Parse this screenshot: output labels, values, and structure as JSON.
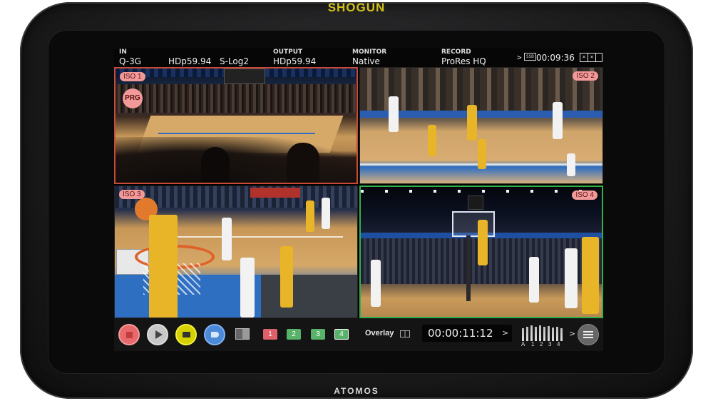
{
  "device": {
    "brand_top": "SHOGUN",
    "brand_top_color": "#d4c21a",
    "brand_bottom": "ATOMOS",
    "brand_bottom_color": "#d8d8d8"
  },
  "status_bar": {
    "in": {
      "label": "IN",
      "value": "Q-3G"
    },
    "in_format": "HDp59.94",
    "in_log": "S-Log2",
    "output": {
      "label": "OUTPUT",
      "value": "HDp59.94"
    },
    "monitor": {
      "label": "MONITOR",
      "value": "Native"
    },
    "record": {
      "label": "RECORD",
      "value": "ProRes HQ"
    },
    "media_label": "SSD",
    "record_time": "00:09:36",
    "chevron": ">"
  },
  "views": [
    {
      "label": "ISO 1",
      "badge": "PRG",
      "border_color": "#c94a36"
    },
    {
      "label": "ISO 2"
    },
    {
      "label": "ISO 3"
    },
    {
      "label": "ISO 4",
      "border_color": "#2fb24a"
    }
  ],
  "controls": {
    "record_color": "#e8696b",
    "play_color": "#c8c8c8",
    "yellow_color": "#d6d200",
    "blue_color": "#4b8ad8",
    "inputs": [
      "1",
      "2",
      "3",
      "4"
    ],
    "overlay_label": "Overlay",
    "timecode": "00:00:11:12",
    "timecode_chevron": ">",
    "audio_labels": [
      "A",
      "1",
      "2",
      "3",
      "4"
    ],
    "audio_chevron": ">",
    "icons": [
      "record-icon",
      "play-icon",
      "yellow-tag-icon",
      "blue-tag-icon",
      "layout-icon",
      "overlay-icon",
      "settings-sliders-icon"
    ]
  }
}
